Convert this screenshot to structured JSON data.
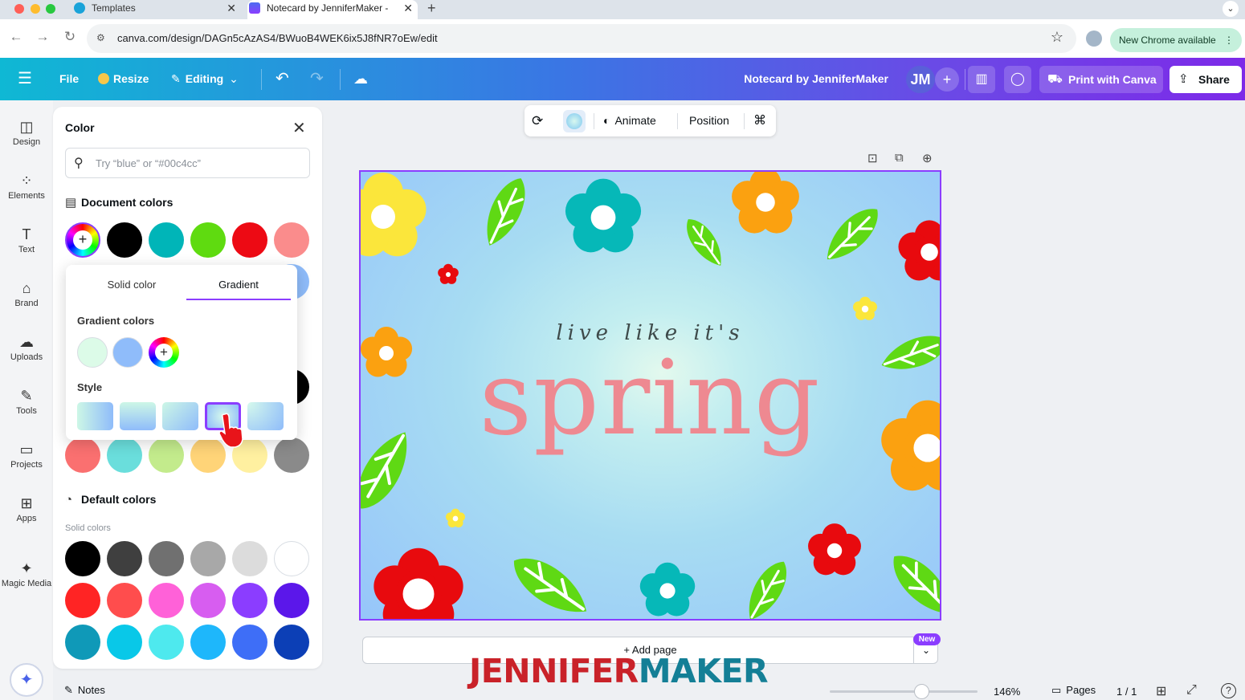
{
  "browser": {
    "tabs": [
      {
        "title": "Templates"
      },
      {
        "title": "Notecard by JenniferMaker -"
      }
    ],
    "url": "canva.com/design/DAGn5cAzAS4/BWuoB4WEK6ix5J8fNR7oEw/edit",
    "update_label": "New Chrome available"
  },
  "header": {
    "file": "File",
    "resize": "Resize",
    "editing": "Editing",
    "doc_title": "Notecard by JenniferMaker",
    "avatar_initials": "JM",
    "print": "Print with Canva",
    "share": "Share"
  },
  "rail": [
    {
      "label": "Design",
      "icon": "design-icon"
    },
    {
      "label": "Elements",
      "icon": "elements-icon"
    },
    {
      "label": "Text",
      "icon": "text-icon"
    },
    {
      "label": "Brand",
      "icon": "brand-icon"
    },
    {
      "label": "Uploads",
      "icon": "uploads-icon"
    },
    {
      "label": "Tools",
      "icon": "tools-icon"
    },
    {
      "label": "Projects",
      "icon": "projects-icon"
    },
    {
      "label": "Apps",
      "icon": "apps-icon"
    },
    {
      "label": "Magic Media",
      "icon": "magic-media-icon"
    }
  ],
  "color_panel": {
    "title": "Color",
    "search_placeholder": "Try “blue” or “#00c4cc”",
    "document_colors_label": "Document colors",
    "document_colors": [
      "#000000",
      "#00b5b8",
      "#5fdb10",
      "#ed0a14",
      "#fa8c8c"
    ],
    "document_colors_row2": [
      "#fa7070",
      "#6adedc",
      "#c3eb8c",
      "#ffd478",
      "#fff0a0",
      "#8a8a8a"
    ],
    "default_colors_label": "Default colors",
    "solid_colors_label": "Solid colors",
    "solid_colors": [
      [
        "#000000",
        "#3f3f3f",
        "#707070",
        "#a8a8a8",
        "#dcdcdc",
        "#ffffff"
      ],
      [
        "#ff2424",
        "#ff4d4d",
        "#ff61d8",
        "#d75df0",
        "#8b3dff",
        "#5b17ea"
      ],
      [
        "#0f99b8",
        "#09c8e8",
        "#4ee9ee",
        "#1eb7fb",
        "#3e6ef7",
        "#0c3fb6"
      ]
    ]
  },
  "gradient_popup": {
    "tab_solid": "Solid color",
    "tab_gradient": "Gradient",
    "gradient_colors_label": "Gradient colors",
    "gradient_colors": [
      "#dcfbe8",
      "#8fbcfa"
    ],
    "style_label": "Style",
    "selected_style_index": 3
  },
  "float_toolbar": {
    "animate": "Animate",
    "position": "Position"
  },
  "design": {
    "tagline": "live like it's",
    "headline": "spring"
  },
  "canvas_footer": {
    "add_page": "+ Add page",
    "new_badge": "New"
  },
  "watermark": {
    "part1": "JENNIFER",
    "part2": "MAKER"
  },
  "footer": {
    "notes": "Notes",
    "zoom": "146%",
    "zoom_fraction": 0.62,
    "pages": "Pages",
    "page_count": "1 / 1"
  }
}
